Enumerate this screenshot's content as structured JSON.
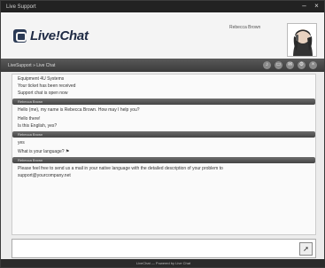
{
  "window": {
    "title": "Live Support",
    "controls": [
      "–",
      "×"
    ]
  },
  "header": {
    "logo_text": "Live!Chat",
    "operator": "Rebecca Brown"
  },
  "toolbar": {
    "title": "LiveSupport » Live Chat",
    "icons": [
      "sound-icon",
      "print-icon",
      "email-icon",
      "settings-icon",
      "close-icon"
    ]
  },
  "messages": [
    {
      "type": "msg",
      "lines": [
        "Equipment 4U Systems",
        "Your ticket has been received",
        "Support chat is open now"
      ]
    },
    {
      "type": "bar",
      "text": "Rebecca Brown"
    },
    {
      "type": "msg",
      "lines": [
        "Hello (me), my name is Rebecca Brown. How may I help you?"
      ]
    },
    {
      "type": "msg",
      "lines": [
        "Hello there!",
        "Is this English, yes?"
      ]
    },
    {
      "type": "bar",
      "text": "Rebecca Brown"
    },
    {
      "type": "msg",
      "lines": [
        "yes"
      ]
    },
    {
      "type": "msg",
      "lines": [
        "What is your language? "
      ]
    },
    {
      "type": "bar",
      "text": "Rebecca Brown"
    },
    {
      "type": "msg",
      "lines": [
        "Please feel free to send us a mail in your native language with the detailed description of your problem to",
        "support@yourcompany.net"
      ]
    }
  ],
  "input": {
    "value": "",
    "placeholder": ""
  },
  "footer": {
    "text": "LiveChat — Powered by Live Chat"
  }
}
